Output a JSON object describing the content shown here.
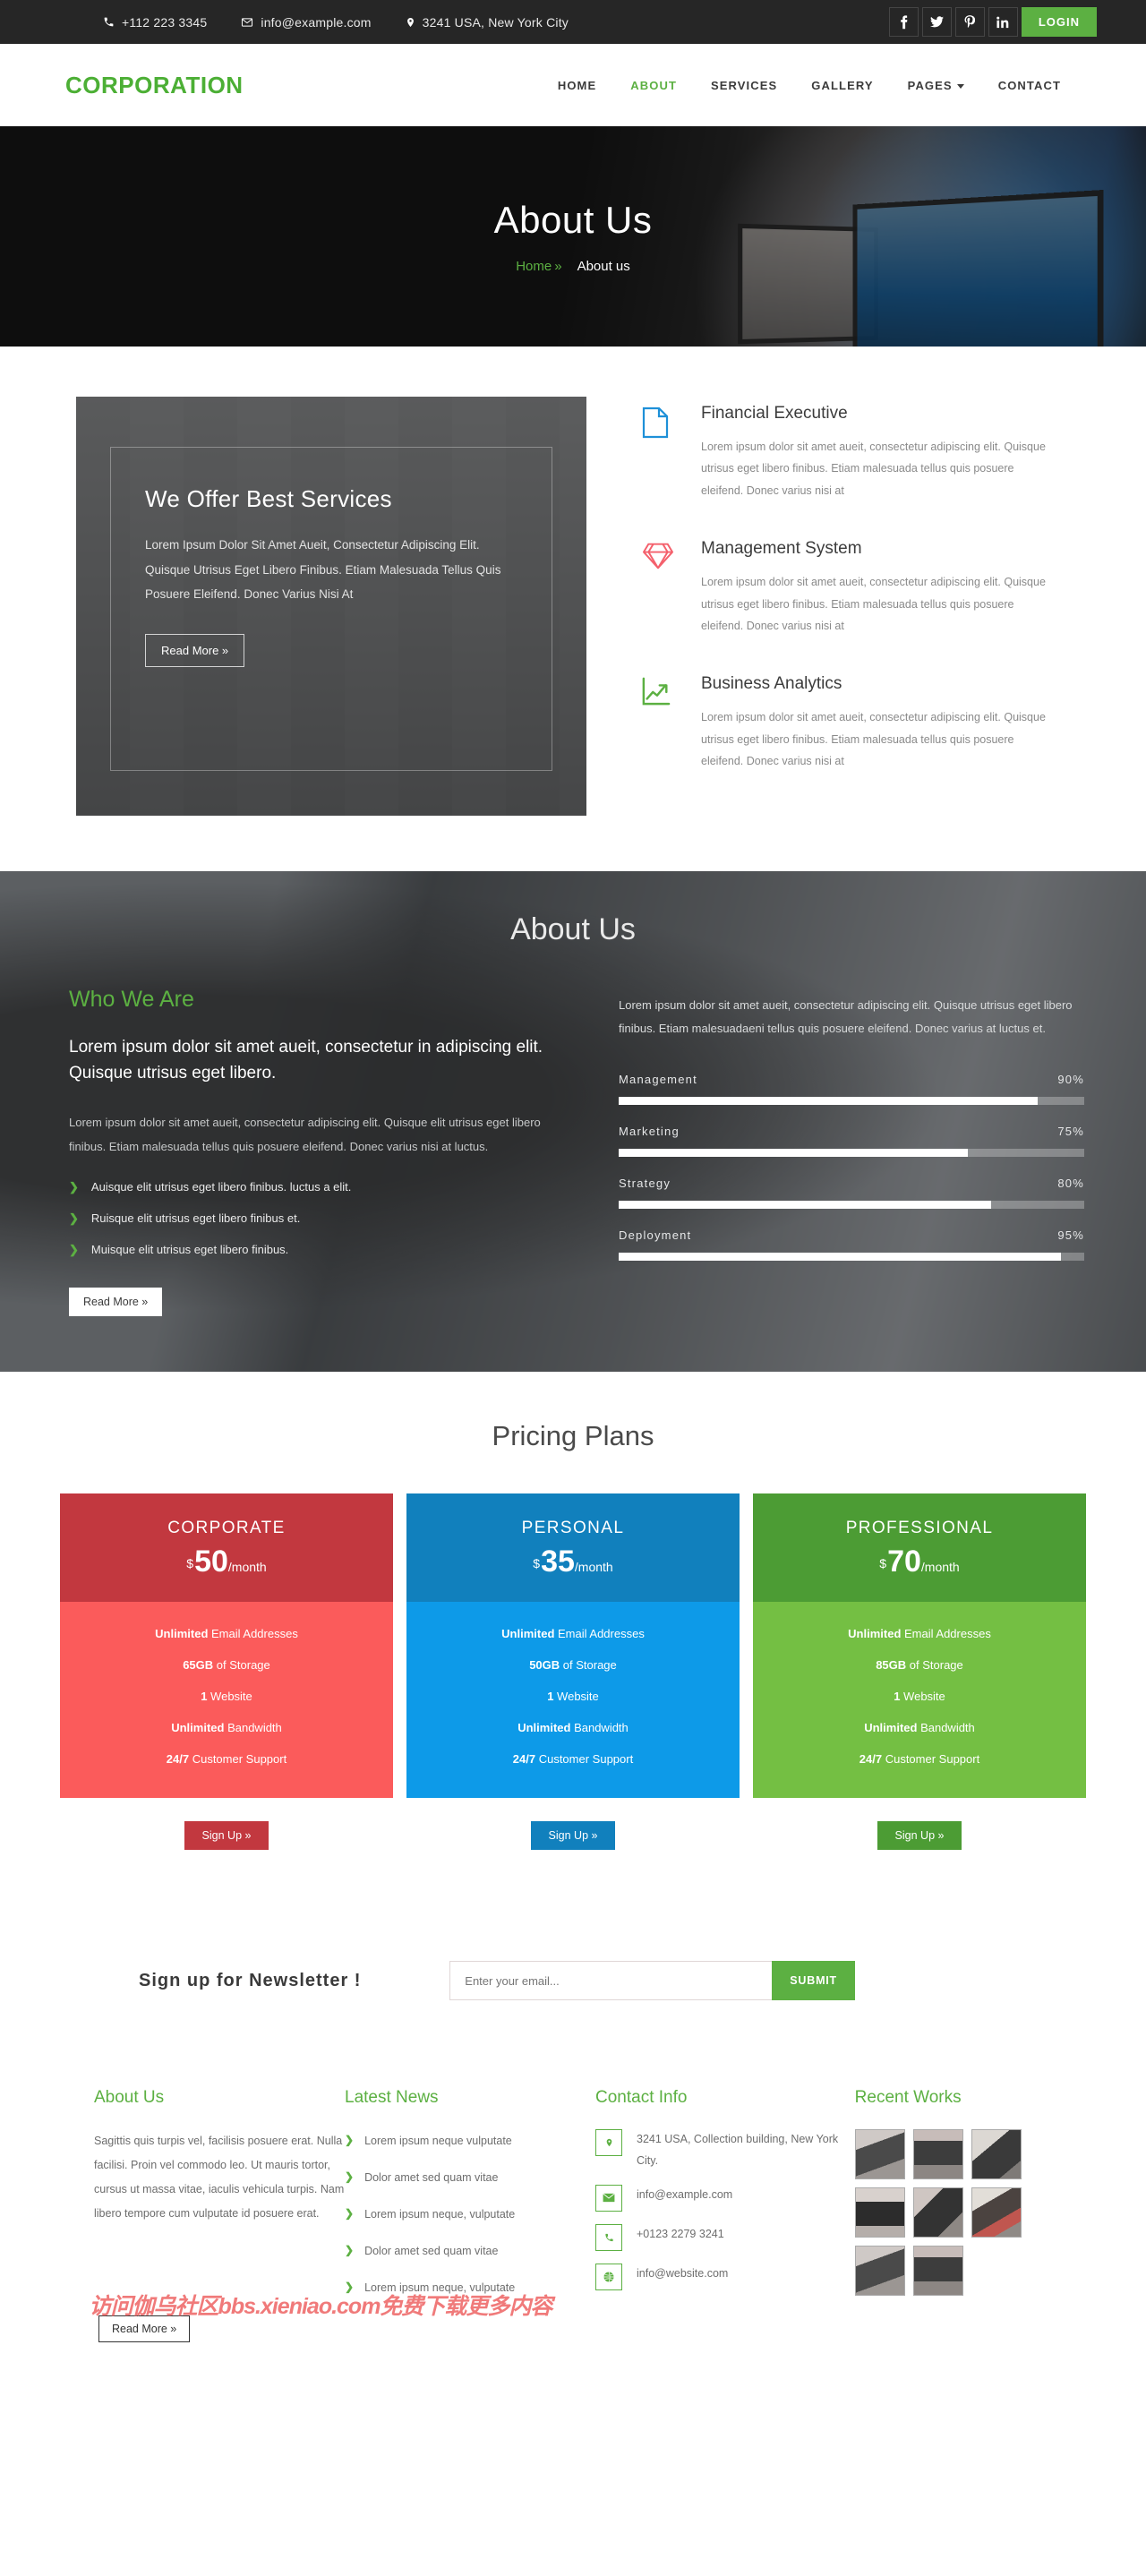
{
  "topbar": {
    "phone": "+112 223 3345",
    "email": "info@example.com",
    "address": "3241 USA, New York City",
    "socials": [
      {
        "name": "facebook",
        "glyph": "f"
      },
      {
        "name": "twitter",
        "glyph": "t"
      },
      {
        "name": "pinterest",
        "glyph": "P"
      },
      {
        "name": "linkedin",
        "glyph": "in"
      }
    ],
    "login_label": "LOGIN"
  },
  "nav": {
    "logo": "CORPORATION",
    "items": [
      {
        "label": "HOME",
        "active": false
      },
      {
        "label": "ABOUT",
        "active": true
      },
      {
        "label": "SERVICES",
        "active": false
      },
      {
        "label": "GALLERY",
        "active": false
      },
      {
        "label": "PAGES",
        "active": false,
        "dropdown": true
      },
      {
        "label": "CONTACT",
        "active": false
      }
    ]
  },
  "hero": {
    "title": "About Us",
    "breadcrumb_home": "Home",
    "breadcrumb_sep": "»",
    "breadcrumb_current": "About us"
  },
  "promo": {
    "title": "We Offer Best Services",
    "body": "Lorem Ipsum Dolor Sit Amet Aueit, Consectetur Adipiscing Elit. Quisque Utrisus Eget Libero Finibus. Etiam Malesuada Tellus Quis Posuere Eleifend. Donec Varius Nisi At",
    "button": "Read More »"
  },
  "features": [
    {
      "icon": "document-icon",
      "color": "#1e90d8",
      "title": "Financial Executive",
      "body": "Lorem ipsum dolor sit amet aueit, consectetur adipiscing elit. Quisque utrisus eget libero finibus. Etiam malesuada tellus quis posuere eleifend. Donec varius nisi at"
    },
    {
      "icon": "diamond-icon",
      "color": "#f4606c",
      "title": "Management System",
      "body": "Lorem ipsum dolor sit amet aueit, consectetur adipiscing elit. Quisque utrisus eget libero finibus. Etiam malesuada tellus quis posuere eleifend. Donec varius nisi at"
    },
    {
      "icon": "chart-growth-icon",
      "color": "#5cb042",
      "title": "Business Analytics",
      "body": "Lorem ipsum dolor sit amet aueit, consectetur adipiscing elit. Quisque utrisus eget libero finibus. Etiam malesuada tellus quis posuere eleifend. Donec varius nisi at"
    }
  ],
  "about": {
    "heading": "About Us",
    "subheading": "Who We Are",
    "lead": "Lorem ipsum dolor sit amet aueit, consectetur in adipiscing elit. Quisque utrisus eget libero.",
    "body": "Lorem ipsum dolor sit amet aueit, consectetur adipiscing elit. Quisque elit utrisus eget libero finibus. Etiam malesuada tellus quis posuere eleifend. Donec varius nisi at luctus.",
    "checks": [
      "Auisque elit utrisus eget libero finibus. luctus a elit.",
      "Ruisque elit utrisus eget libero finibus et.",
      "Muisque elit utrisus eget libero finibus."
    ],
    "button": "Read More »",
    "right_intro": "Lorem ipsum dolor sit amet aueit, consectetur adipiscing elit. Quisque utrisus eget libero finibus. Etiam malesuadaeni tellus quis posuere eleifend. Donec varius at luctus et."
  },
  "chart_data": {
    "type": "bar",
    "title": "",
    "orientation": "horizontal",
    "categories": [
      "Management",
      "Marketing",
      "Strategy",
      "Deployment"
    ],
    "values": [
      90,
      75,
      80,
      95
    ],
    "value_labels": [
      "90%",
      "75%",
      "80%",
      "95%"
    ],
    "xlabel": "",
    "ylabel": "",
    "ylim": [
      0,
      100
    ],
    "grid": false,
    "legend": "none"
  },
  "pricing": {
    "heading": "Pricing Plans",
    "plans": [
      {
        "name": "CORPORATE",
        "currency": "$",
        "amount": "50",
        "period": "/month",
        "head_color": "#c2383f",
        "body_color": "#fb5b5b",
        "button_color": "#c2383f",
        "button": "Sign Up »",
        "features": [
          {
            "strong": "Unlimited",
            "rest": " Email Addresses"
          },
          {
            "strong": "65GB",
            "rest": " of Storage"
          },
          {
            "strong": "1",
            "rest": " Website"
          },
          {
            "strong": "Unlimited",
            "rest": " Bandwidth"
          },
          {
            "strong": "24/7",
            "rest": " Customer Support"
          }
        ]
      },
      {
        "name": "PERSONAL",
        "currency": "$",
        "amount": "35",
        "period": "/month",
        "head_color": "#1180bd",
        "body_color": "#0d9ae8",
        "button_color": "#1180bd",
        "button": "Sign Up »",
        "features": [
          {
            "strong": "Unlimited",
            "rest": " Email Addresses"
          },
          {
            "strong": "50GB",
            "rest": " of Storage"
          },
          {
            "strong": "1",
            "rest": " Website"
          },
          {
            "strong": "Unlimited",
            "rest": " Bandwidth"
          },
          {
            "strong": "24/7",
            "rest": " Customer Support"
          }
        ]
      },
      {
        "name": "PROFESSIONAL",
        "currency": "$",
        "amount": "70",
        "period": "/month",
        "head_color": "#4c9c34",
        "body_color": "#74bf43",
        "button_color": "#4c9c34",
        "button": "Sign Up »",
        "features": [
          {
            "strong": "Unlimited",
            "rest": " Email Addresses"
          },
          {
            "strong": "85GB",
            "rest": " of Storage"
          },
          {
            "strong": "1",
            "rest": " Website"
          },
          {
            "strong": "Unlimited",
            "rest": " Bandwidth"
          },
          {
            "strong": "24/7",
            "rest": " Customer Support"
          }
        ]
      }
    ]
  },
  "newsletter": {
    "title": "Sign up for Newsletter !",
    "placeholder": "Enter your email...",
    "submit": "SUBMIT"
  },
  "footer": {
    "about": {
      "title": "About Us",
      "body": "Sagittis quis turpis vel, facilisis posuere erat. Nulla facilisi. Proin vel commodo leo. Ut mauris tortor, cursus ut massa vitae, iaculis vehicula turpis. Nam libero tempore cum vulputate id posuere erat."
    },
    "news": {
      "title": "Latest News",
      "items": [
        "Lorem ipsum neque vulputate",
        "Dolor amet sed quam vitae",
        "Lorem ipsum neque, vulputate",
        "Dolor amet sed quam vitae",
        "Lorem ipsum neque, vulputate"
      ]
    },
    "contact": {
      "title": "Contact Info",
      "items": [
        {
          "icon": "map-pin-icon",
          "text": "3241 USA, Collection building, New York City."
        },
        {
          "icon": "envelope-icon",
          "text": "info@example.com"
        },
        {
          "icon": "phone-icon",
          "text": "+0123 2279 3241"
        },
        {
          "icon": "globe-icon",
          "text": "info@website.com"
        }
      ]
    },
    "works": {
      "title": "Recent Works",
      "thumbs": [
        "work-1",
        "work-2",
        "work-3",
        "work-4",
        "work-5",
        "work-6",
        "work-7",
        "work-8"
      ]
    },
    "read_more": "Read More »",
    "watermark": "访问伽乌社区bbs.xieniao.com免费下载更多内容"
  }
}
